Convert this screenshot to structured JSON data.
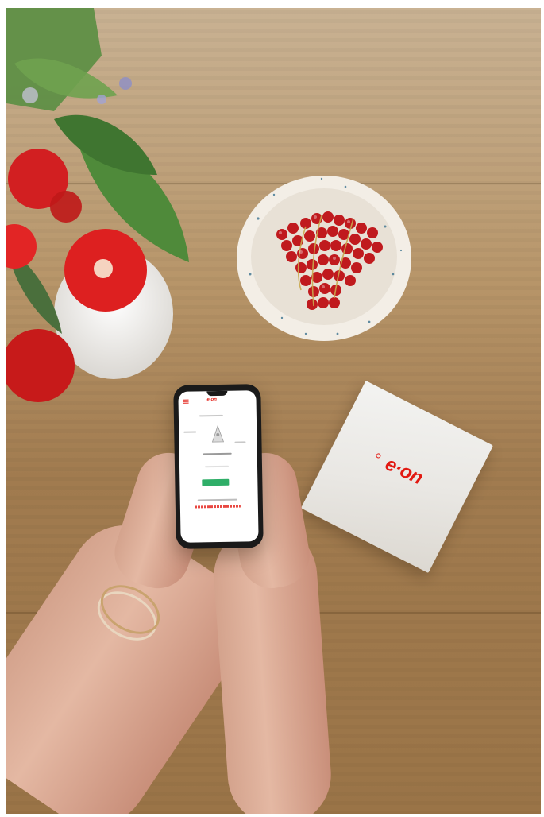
{
  "scene": {
    "router_logo_text": "e·on",
    "app_logo_text": "e.on"
  },
  "colors": {
    "brand_red": "#e21a12",
    "wood_light": "#c9b293",
    "wood_dark": "#9a7447",
    "app_green": "#2fae68"
  }
}
